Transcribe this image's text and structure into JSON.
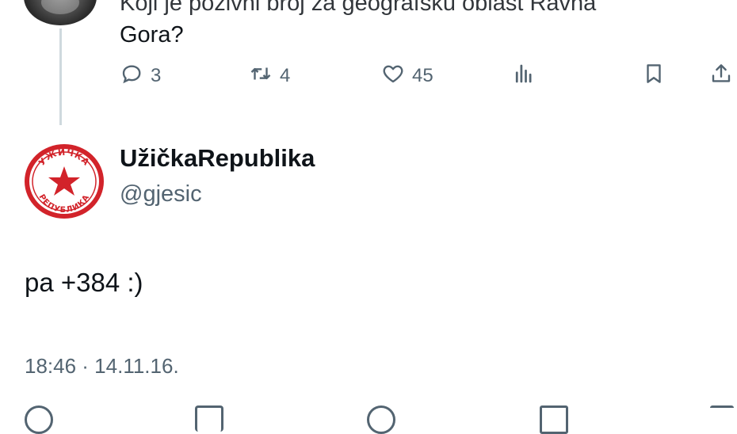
{
  "parent_tweet": {
    "text_partial_top": "Koji je pozivni broj za geografsku oblast Ravna",
    "text_line2": "Gora?",
    "actions": {
      "reply_count": "3",
      "retweet_count": "4",
      "like_count": "45"
    },
    "icons": [
      "reply-icon",
      "retweet-icon",
      "like-icon",
      "views-icon",
      "bookmark-icon",
      "share-icon"
    ]
  },
  "reply_tweet": {
    "display_name": "UžičkaRepublika",
    "handle": "@gjesic",
    "text": "pa +384 :)",
    "timestamp": "18:46 · 14.11.16.",
    "avatar_seal_text_top": "УЖИЧКА",
    "avatar_seal_text_bottom": "РЕПУБЛИКА"
  },
  "colors": {
    "text": "#0f1419",
    "muted": "#536471",
    "thread_line": "#cfd9de",
    "seal_red": "#d2232a"
  }
}
